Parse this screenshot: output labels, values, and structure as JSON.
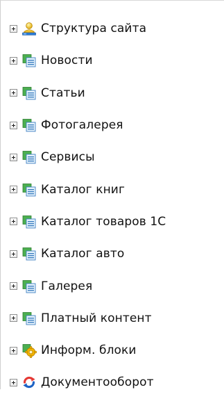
{
  "tree": {
    "items": [
      {
        "label": "Структура сайта",
        "icon": "site-structure-icon"
      },
      {
        "label": "Новости",
        "icon": "infoblock-type-icon"
      },
      {
        "label": "Статьи",
        "icon": "infoblock-type-icon"
      },
      {
        "label": "Фотогалерея",
        "icon": "infoblock-type-icon"
      },
      {
        "label": "Сервисы",
        "icon": "infoblock-type-icon"
      },
      {
        "label": "Каталог книг",
        "icon": "infoblock-type-icon"
      },
      {
        "label": "Каталог товаров 1С",
        "icon": "infoblock-type-icon"
      },
      {
        "label": "Каталог авто",
        "icon": "infoblock-type-icon"
      },
      {
        "label": "Галерея",
        "icon": "infoblock-type-icon"
      },
      {
        "label": "Платный контент",
        "icon": "infoblock-type-icon"
      },
      {
        "label": "Информ. блоки",
        "icon": "infoblocks-settings-icon"
      },
      {
        "label": "Документооборот",
        "icon": "workflow-icon"
      }
    ]
  },
  "colors": {
    "label_text": "#111111",
    "expander_border": "#8e8f8f",
    "panel_border": "#cfcfcf"
  }
}
